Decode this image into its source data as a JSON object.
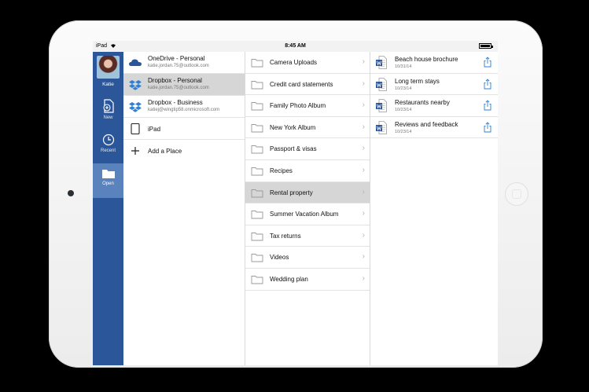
{
  "status": {
    "device": "iPad",
    "time": "8:45 AM"
  },
  "rail": {
    "user": "Katie",
    "items": [
      {
        "label": "New"
      },
      {
        "label": "Recent"
      },
      {
        "label": "Open"
      }
    ]
  },
  "places": [
    {
      "name": "OneDrive - Personal",
      "sub": "katie.jordan.75@outlook.com",
      "icon": "cloud-icon"
    },
    {
      "name": "Dropbox - Personal",
      "sub": "katie.jordan.75@outlook.com",
      "icon": "dropbox-icon"
    },
    {
      "name": "Dropbox - Business",
      "sub": "katiej@wingtip58.onmicrosoft.com",
      "icon": "dropbox-icon"
    },
    {
      "name": "iPad",
      "icon": "ipad-icon"
    },
    {
      "name": "Add a Place",
      "icon": "plus-icon"
    }
  ],
  "folders": [
    "Camera Uploads",
    "Credit card statements",
    "Family Photo Album",
    "New York Album",
    "Passport & visas",
    "Recipes",
    "Rental property",
    "Summer Vacation Album",
    "Tax returns",
    "Videos",
    "Wedding plan"
  ],
  "documents": [
    {
      "name": "Beach house brochure",
      "date": "10/31/14"
    },
    {
      "name": "Long term stays",
      "date": "10/23/14"
    },
    {
      "name": "Restaurants nearby",
      "date": "10/23/14"
    },
    {
      "name": "Reviews and feedback",
      "date": "10/23/14"
    }
  ],
  "colors": {
    "rail": "#2b579a",
    "rail_active": "#5a82bd",
    "selected_row": "#d6d6d6",
    "word_blue": "#2b579a"
  }
}
